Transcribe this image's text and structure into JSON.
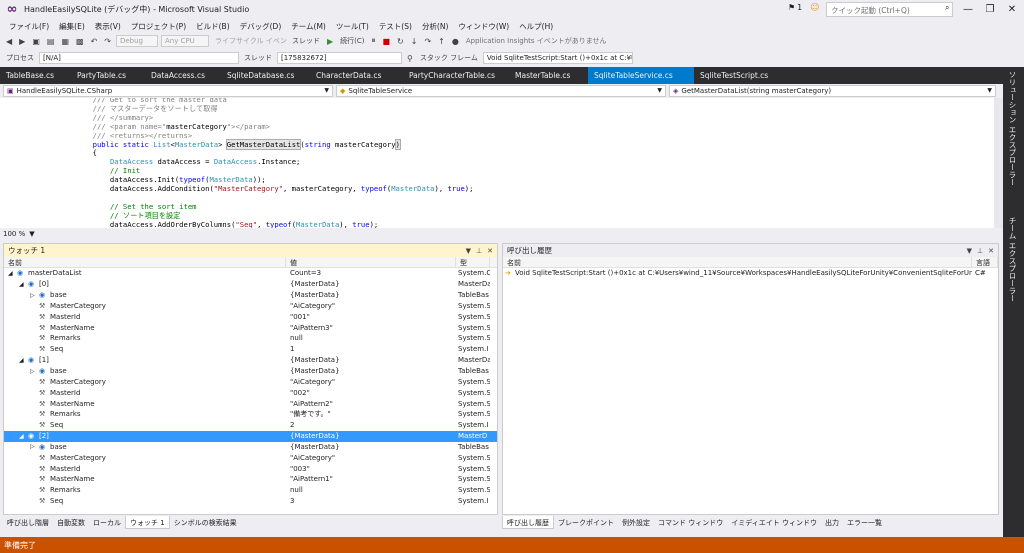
{
  "titlebar": {
    "title": "HandleEasilySQLite (デバッグ中) - Microsoft Visual Studio",
    "notif_count": "1",
    "quicklaunch_placeholder": "クイック起動 (Ctrl+Q)"
  },
  "menu": [
    "ファイル(F)",
    "編集(E)",
    "表示(V)",
    "プロジェクト(P)",
    "ビルド(B)",
    "デバッグ(D)",
    "チーム(M)",
    "ツール(T)",
    "テスト(S)",
    "分析(N)",
    "ウィンドウ(W)",
    "ヘルプ(H)"
  ],
  "toolbar1": {
    "config": "Debug",
    "platform": "Any CPU",
    "lifecycle": "ライフサイクル イベント",
    "thread_label": "スレッド",
    "continue": "続行(C)",
    "insights": "Application Insights イベントがありません"
  },
  "toolbar2": {
    "process_label": "プロセス",
    "process_value": "[N/A]",
    "thread_value": "[175832672]",
    "stackframe_label": "スタック フレーム",
    "stackframe_value": "Void SqliteTestScript:Start ()+0x1c at C:¥Us"
  },
  "doctabs": [
    {
      "label": "TableBase.cs",
      "active": false
    },
    {
      "label": "PartyTable.cs",
      "active": false
    },
    {
      "label": "DataAccess.cs",
      "active": false
    },
    {
      "label": "SqliteDatabase.cs",
      "active": false
    },
    {
      "label": "CharacterData.cs",
      "active": false
    },
    {
      "label": "PartyCharacterTable.cs",
      "active": false
    },
    {
      "label": "MasterTable.cs",
      "active": false
    },
    {
      "label": "SqliteTableService.cs",
      "active": true
    },
    {
      "label": "SqliteTestScript.cs",
      "active": false
    }
  ],
  "righttabs": [
    "ソリューション エクスプローラー",
    "チーム エクスプローラー"
  ],
  "navbar": {
    "project": "HandleEasilySQLite.CSharp",
    "class": "SqliteTableService",
    "member": "GetMasterDataList(string masterCategory)"
  },
  "editor": {
    "zoom": "100 %"
  },
  "watch": {
    "title": "ウォッチ 1",
    "headers": [
      "名前",
      "値",
      "型"
    ],
    "rows": [
      {
        "indent": 0,
        "exp": "◢",
        "name": "masterDataList",
        "value": "Count=3",
        "type": "System.C",
        "sel": false
      },
      {
        "indent": 1,
        "exp": "◢",
        "name": "[0]",
        "value": "{MasterData}",
        "type": "MasterDa",
        "sel": false
      },
      {
        "indent": 2,
        "exp": "▷",
        "name": "base",
        "value": "{MasterData}",
        "type": "TableBas",
        "sel": false
      },
      {
        "indent": 2,
        "exp": "",
        "name": "MasterCategory",
        "value": "\"AiCategory\"",
        "type": "System.S",
        "sel": false
      },
      {
        "indent": 2,
        "exp": "",
        "name": "MasterId",
        "value": "\"001\"",
        "type": "System.S",
        "sel": false
      },
      {
        "indent": 2,
        "exp": "",
        "name": "MasterName",
        "value": "\"AiPattern3\"",
        "type": "System.S",
        "sel": false
      },
      {
        "indent": 2,
        "exp": "",
        "name": "Remarks",
        "value": "null",
        "type": "System.S",
        "sel": false
      },
      {
        "indent": 2,
        "exp": "",
        "name": "Seq",
        "value": "1",
        "type": "System.I",
        "sel": false
      },
      {
        "indent": 1,
        "exp": "◢",
        "name": "[1]",
        "value": "{MasterData}",
        "type": "MasterDa",
        "sel": false
      },
      {
        "indent": 2,
        "exp": "▷",
        "name": "base",
        "value": "{MasterData}",
        "type": "TableBas",
        "sel": false
      },
      {
        "indent": 2,
        "exp": "",
        "name": "MasterCategory",
        "value": "\"AiCategory\"",
        "type": "System.S",
        "sel": false
      },
      {
        "indent": 2,
        "exp": "",
        "name": "MasterId",
        "value": "\"002\"",
        "type": "System.S",
        "sel": false
      },
      {
        "indent": 2,
        "exp": "",
        "name": "MasterName",
        "value": "\"AiPattern2\"",
        "type": "System.S",
        "sel": false
      },
      {
        "indent": 2,
        "exp": "",
        "name": "Remarks",
        "value": "\"備考です。\"",
        "type": "System.S",
        "sel": false
      },
      {
        "indent": 2,
        "exp": "",
        "name": "Seq",
        "value": "2",
        "type": "System.I",
        "sel": false
      },
      {
        "indent": 1,
        "exp": "◢",
        "name": "[2]",
        "value": "{MasterData}",
        "type": "MasterD",
        "sel": true
      },
      {
        "indent": 2,
        "exp": "▷",
        "name": "base",
        "value": "{MasterData}",
        "type": "TableBas",
        "sel": false
      },
      {
        "indent": 2,
        "exp": "",
        "name": "MasterCategory",
        "value": "\"AiCategory\"",
        "type": "System.S",
        "sel": false
      },
      {
        "indent": 2,
        "exp": "",
        "name": "MasterId",
        "value": "\"003\"",
        "type": "System.S",
        "sel": false
      },
      {
        "indent": 2,
        "exp": "",
        "name": "MasterName",
        "value": "\"AiPattern1\"",
        "type": "System.S",
        "sel": false
      },
      {
        "indent": 2,
        "exp": "",
        "name": "Remarks",
        "value": "null",
        "type": "System.S",
        "sel": false
      },
      {
        "indent": 2,
        "exp": "",
        "name": "Seq",
        "value": "3",
        "type": "System.I",
        "sel": false
      }
    ],
    "tabs": [
      "呼び出し階層",
      "自動変数",
      "ローカル",
      "ウォッチ 1",
      "シンボルの検索結果"
    ]
  },
  "callstack": {
    "title": "呼び出し履歴",
    "headers": [
      "名前",
      "言語"
    ],
    "rows": [
      {
        "name": "Void SqliteTestScript:Start ()+0x1c at C:¥Users¥wind_11¥Source¥Workspaces¥HandleEasilySQLiteForUnity¥ConvenientSqliteForUnity¥Han",
        "lang": "C#"
      }
    ],
    "tabs": [
      "呼び出し履歴",
      "ブレークポイント",
      "例外設定",
      "コマンド ウィンドウ",
      "イミディエイト ウィンドウ",
      "出力",
      "エラー一覧"
    ]
  },
  "status": {
    "text": "準備完了"
  }
}
